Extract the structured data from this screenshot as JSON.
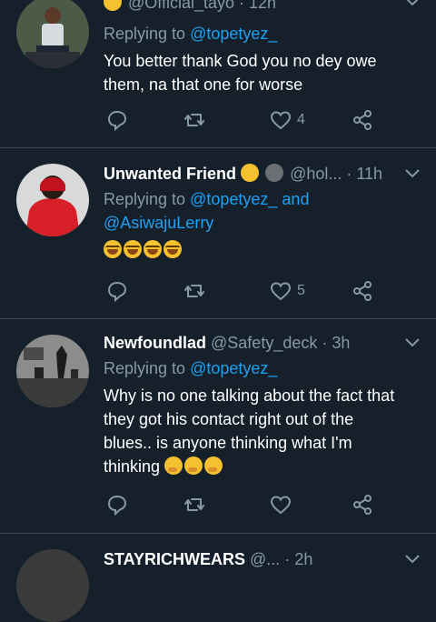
{
  "tweets": [
    {
      "display_name": "",
      "handle": "@Official_tayo",
      "time": "12h",
      "replying_prefix": "Replying to",
      "replying_to": "@topetyez_",
      "replying_and": "",
      "replying_to2": "",
      "body_lines": [
        "You better thank God you no dey owe",
        "them, na that one for worse"
      ],
      "likes": "4"
    },
    {
      "display_name": "Unwanted Friend",
      "handle": "@hol...",
      "time": "11h",
      "replying_prefix": "Replying to",
      "replying_to": "@topetyez_",
      "replying_and": "and",
      "replying_to2": "@AsiwajuLerry",
      "body_lines": [],
      "likes": "5"
    },
    {
      "display_name": "Newfoundlad",
      "handle": "@Safety_deck",
      "time": "3h",
      "replying_prefix": "Replying to",
      "replying_to": "@topetyez_",
      "replying_and": "",
      "replying_to2": "",
      "body_lines": [
        "Why is no one talking about the fact that",
        "they got his contact right out of the",
        "blues.. is anyone thinking what I'm",
        "thinking"
      ],
      "likes": ""
    },
    {
      "display_name": "STAYRICHWEARS",
      "handle": "@...",
      "time": "2h"
    }
  ],
  "icons": {
    "reply": "reply-icon",
    "retweet": "retweet-icon",
    "like": "heart-icon",
    "share": "share-icon",
    "more": "chevron-down-icon"
  },
  "colors": {
    "background": "#15202b",
    "divider": "#38444d",
    "muted": "#8899a6",
    "link": "#1da1f2"
  }
}
